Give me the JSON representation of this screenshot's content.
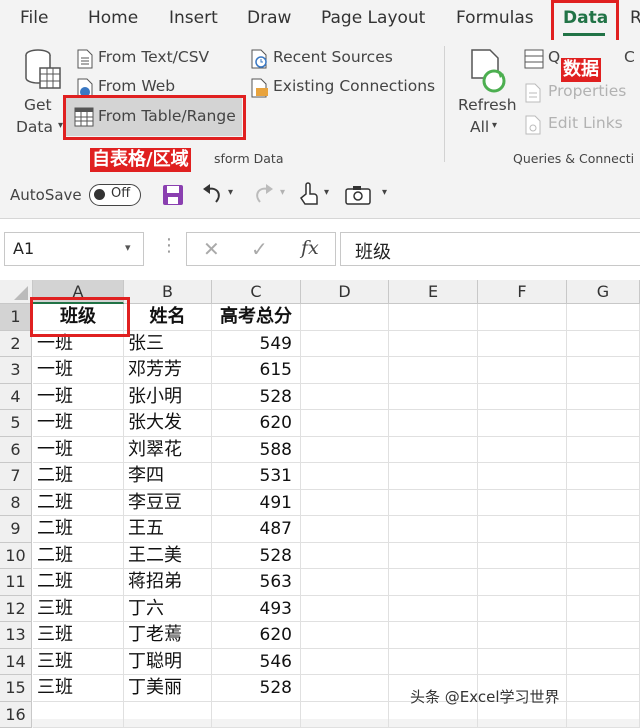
{
  "ribbon_tabs": [
    "File",
    "Home",
    "Insert",
    "Draw",
    "Page Layout",
    "Formulas",
    "Data",
    "R"
  ],
  "active_tab": "Data",
  "get_data": {
    "line1": "Get",
    "line2": "Data"
  },
  "from_text_csv": "From Text/CSV",
  "from_web": "From Web",
  "from_table_range": "From Table/Range",
  "recent_sources": "Recent Sources",
  "existing_connections": "Existing Connections",
  "group_transform_label": "sform Data",
  "refresh": {
    "line1": "Refresh",
    "line2": "All"
  },
  "queries_connections": "Q",
  "properties": "Properties",
  "edit_links": "Edit Links",
  "group_queries_label": "Queries & Connecti",
  "annotation_table": "自表格/区域",
  "annotation_data": "数据",
  "queries_cut": "C",
  "autosave": {
    "label": "AutoSave",
    "state": "Off"
  },
  "name_box": "A1",
  "formula_value": "班级",
  "fx_label": "fx",
  "columns": [
    "A",
    "B",
    "C",
    "D",
    "E",
    "F",
    "G"
  ],
  "rows": [
    {
      "n": "1",
      "a": "班级",
      "b": "姓名",
      "c": "高考总分"
    },
    {
      "n": "2",
      "a": "一班",
      "b": "张三",
      "c": "549"
    },
    {
      "n": "3",
      "a": "一班",
      "b": "邓芳芳",
      "c": "615"
    },
    {
      "n": "4",
      "a": "一班",
      "b": "张小明",
      "c": "528"
    },
    {
      "n": "5",
      "a": "一班",
      "b": "张大发",
      "c": "620"
    },
    {
      "n": "6",
      "a": "一班",
      "b": "刘翠花",
      "c": "588"
    },
    {
      "n": "7",
      "a": "二班",
      "b": "李四",
      "c": "531"
    },
    {
      "n": "8",
      "a": "二班",
      "b": "李豆豆",
      "c": "491"
    },
    {
      "n": "9",
      "a": "二班",
      "b": "王五",
      "c": "487"
    },
    {
      "n": "10",
      "a": "二班",
      "b": "王二美",
      "c": "528"
    },
    {
      "n": "11",
      "a": "二班",
      "b": "蒋招弟",
      "c": "563"
    },
    {
      "n": "12",
      "a": "三班",
      "b": "丁六",
      "c": "493"
    },
    {
      "n": "13",
      "a": "三班",
      "b": "丁老蔫",
      "c": "620"
    },
    {
      "n": "14",
      "a": "三班",
      "b": "丁聪明",
      "c": "546"
    },
    {
      "n": "15",
      "a": "三班",
      "b": "丁美丽",
      "c": "528"
    },
    {
      "n": "16",
      "a": "",
      "b": "",
      "c": ""
    }
  ],
  "watermark": "头条 @Excel学习世界",
  "colors": {
    "accent_red": "#e02020",
    "excel_green": "#217346",
    "save_purple": "#8a3fb0"
  }
}
